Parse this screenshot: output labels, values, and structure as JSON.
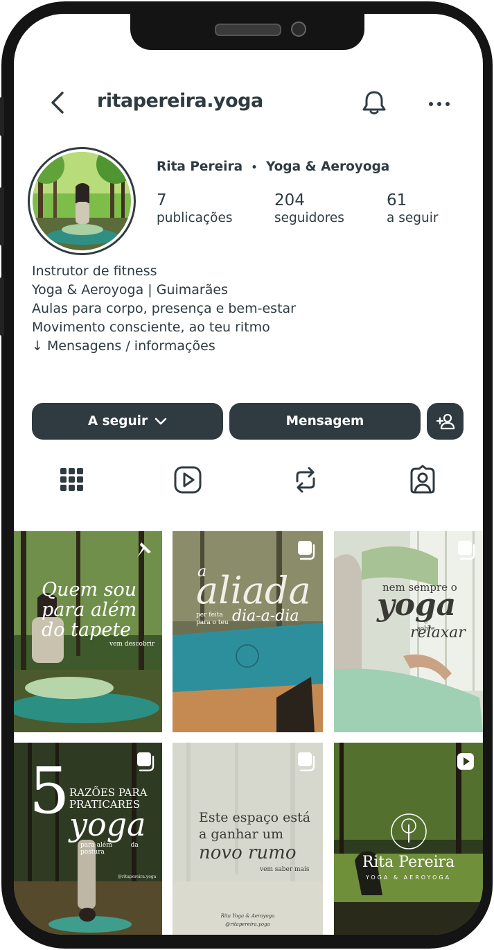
{
  "header": {
    "username": "ritapereira.yoga",
    "back_icon": "chevron-left-icon",
    "notification_icon": "bell-icon",
    "more_icon": "more-horizontal-icon"
  },
  "profile": {
    "full_name": "Rita Pereira",
    "separator": "•",
    "tagline": "Yoga & Aeroyoga",
    "stats": [
      {
        "value": "7",
        "label": "publicações"
      },
      {
        "value": "204",
        "label": "seguidores"
      },
      {
        "value": "61",
        "label": "a seguir"
      }
    ],
    "bio": [
      "Instrutor de fitness",
      "Yoga & Aeroyoga | Guimarães",
      "Aulas para corpo, presença e bem-estar",
      "Movimento consciente, ao teu ritmo",
      "↓ Mensagens / informações"
    ]
  },
  "actions": {
    "following_label": "A seguir",
    "message_label": "Mensagem",
    "add_user_icon": "add-person-icon"
  },
  "tabs": [
    {
      "icon": "grid-icon"
    },
    {
      "icon": "reels-icon"
    },
    {
      "icon": "reposts-icon"
    },
    {
      "icon": "tagged-icon"
    }
  ],
  "posts": [
    {
      "lines": [
        "Quem sou",
        "para além",
        "do tapete"
      ],
      "small": "vem descobrir",
      "badge": "pin-icon"
    },
    {
      "big": "aliada",
      "top": "a",
      "lines": [
        "per feita",
        "para o teu"
      ],
      "script": "dia-a-dia",
      "badge": "carousel-icon"
    },
    {
      "lines": [
        "nem sempre o"
      ],
      "big": "yoga",
      "small_lines": [
        "é",
        "sobre"
      ],
      "script": "relaxar",
      "badge": "carousel-icon"
    },
    {
      "num": "5",
      "lines": [
        "RAZÕES PARA",
        "PRATICARES"
      ],
      "big": "yoga",
      "small_lines": [
        "para além",
        "da postura"
      ],
      "handle": "@ritapereira.yoga",
      "badge": "carousel-icon"
    },
    {
      "lines": [
        "Este espaço está",
        "a ganhar um"
      ],
      "big": "novo rumo",
      "small": "vem saber mais",
      "footer": [
        "Rita Yoga & Aeroyoga",
        "@ritapereira.yoga"
      ],
      "badge": "carousel-icon"
    },
    {
      "title": "Rita Pereira",
      "subtitle": "YOGA & AEROYOGA",
      "badge": "reel-icon"
    }
  ]
}
